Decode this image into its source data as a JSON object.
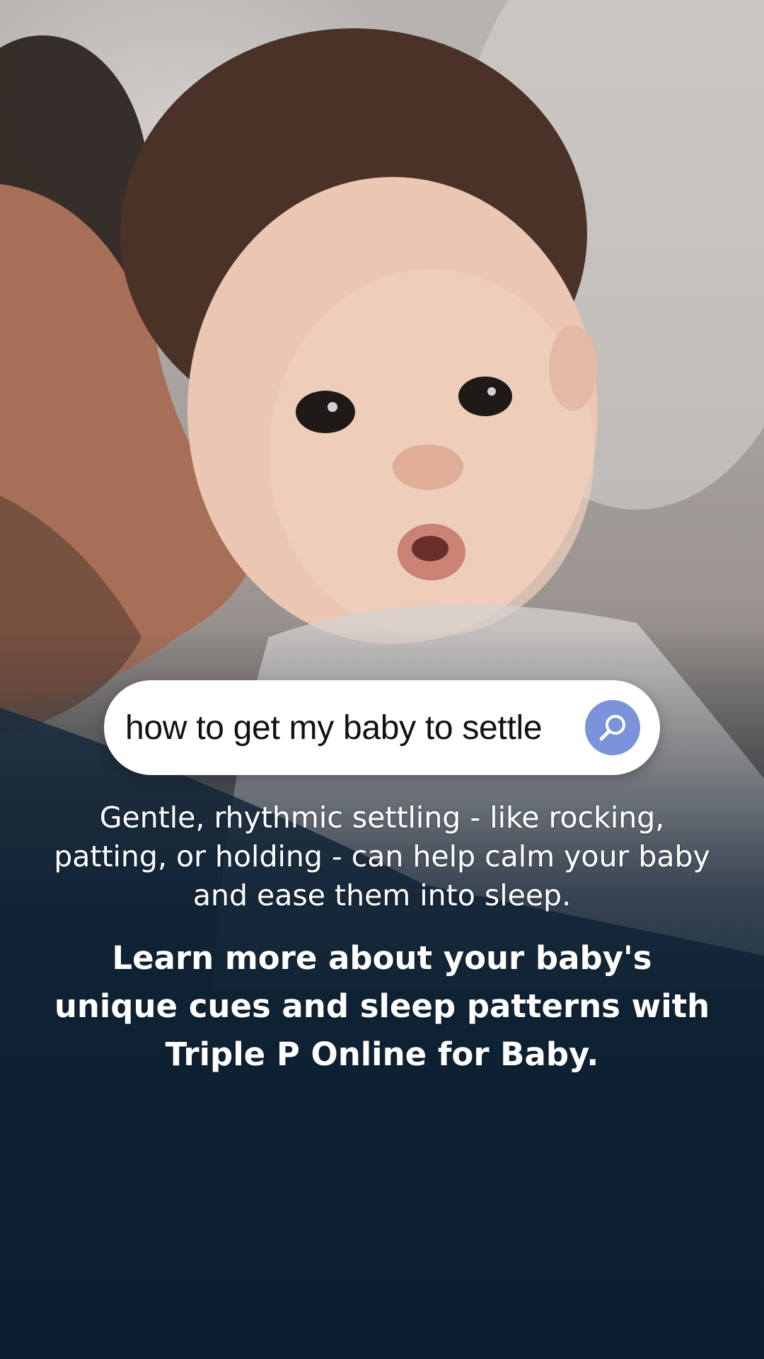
{
  "search": {
    "query": "how to get my baby to settle",
    "icon": "search-icon"
  },
  "content": {
    "tip": "Gentle, rhythmic settling - like rocking, patting, or holding - can help calm your baby and ease them into sleep.",
    "cta": "Learn more about your baby's unique cues and sleep patterns with Triple P Online for Baby."
  },
  "colors": {
    "search_button": "#7b93db",
    "overlay_dark": "#13263a"
  }
}
